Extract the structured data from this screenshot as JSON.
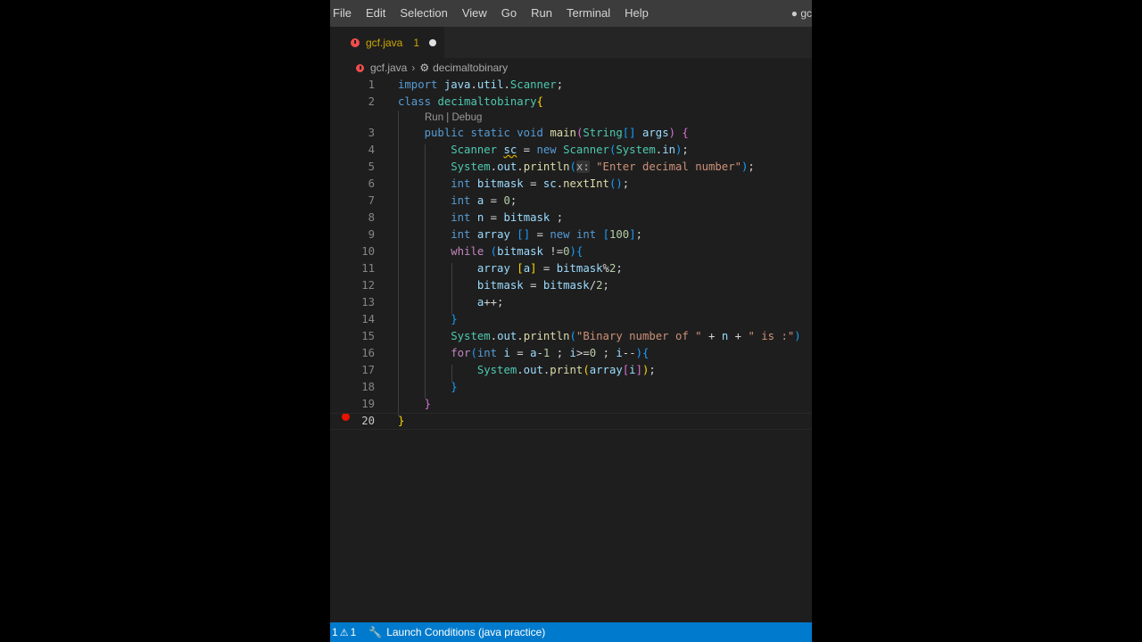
{
  "menu": [
    "File",
    "Edit",
    "Selection",
    "View",
    "Go",
    "Run",
    "Terminal",
    "Help"
  ],
  "title_fragment": "● gc",
  "tab": {
    "name": "gcf.java",
    "problem_count": "1"
  },
  "breadcrumb": {
    "file": "gcf.java",
    "symbol": "decimaltobinary"
  },
  "codelens": "Run | Debug",
  "inlay_hint": "x:",
  "code_lines": [
    "import java.util.Scanner;",
    "class decimaltobinary{",
    "    public static void main(String[] args) {",
    "        Scanner sc = new Scanner(System.in);",
    "        System.out.println(x: \"Enter decimal number\");",
    "        int bitmask = sc.nextInt();",
    "        int a = 0;",
    "        int n = bitmask ;",
    "        int array [] = new int [100];",
    "        while (bitmask !=0){",
    "            array [a] = bitmask%2;",
    "            bitmask = bitmask/2;",
    "            a++;",
    "        }",
    "        System.out.println(\"Binary number of \" + n + \" is :\")",
    "        for(int i = a-1 ; i>=0 ; i--){",
    "            System.out.print(array[i]);",
    "        }",
    "    }",
    "}"
  ],
  "line_numbers": [
    "1",
    "2",
    "3",
    "4",
    "5",
    "6",
    "7",
    "8",
    "9",
    "10",
    "11",
    "12",
    "13",
    "14",
    "15",
    "16",
    "17",
    "18",
    "19",
    "20"
  ],
  "statusbar": {
    "errors": "1",
    "warnings": "1",
    "launch": "Launch Conditions (java practice)"
  },
  "icons": {
    "error": "error-circle-icon",
    "symbol": "class-symbol-icon",
    "breakpoint": "breakpoint-icon",
    "warning": "warning-triangle-icon",
    "launch": "wrench-icon"
  },
  "colors": {
    "statusbar": "#007acc",
    "error": "#f14c4c",
    "modified_tab": "#cca700",
    "breakpoint": "#e51400"
  }
}
